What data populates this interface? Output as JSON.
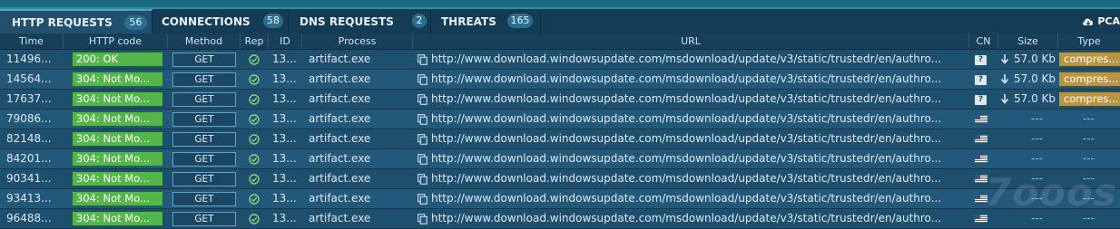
{
  "tabs": [
    {
      "label": "HTTP REQUESTS",
      "count": "56"
    },
    {
      "label": "CONNECTIONS",
      "count": "58"
    },
    {
      "label": "DNS REQUESTS",
      "count": "2"
    },
    {
      "label": "THREATS",
      "count": "165"
    }
  ],
  "pcap_label": "PCA",
  "columns": [
    "Time",
    "HTTP code",
    "Method",
    "Rep",
    "ID",
    "Process",
    "URL",
    "CN",
    "Size",
    "Type"
  ],
  "rows": [
    {
      "time": "11496...",
      "code": "200: OK",
      "method": "GET",
      "id": "13...",
      "process": "artifact.exe",
      "url": "http://www.download.windowsupdate.com/msdownload/update/v3/static/trustedr/en/authro...",
      "cn": "?",
      "size": "57.0 Kb",
      "type": "compres..."
    },
    {
      "time": "14564...",
      "code": "304: Not Mo...",
      "method": "GET",
      "id": "13...",
      "process": "artifact.exe",
      "url": "http://www.download.windowsupdate.com/msdownload/update/v3/static/trustedr/en/authro...",
      "cn": "?",
      "size": "57.0 Kb",
      "type": "compres..."
    },
    {
      "time": "17637...",
      "code": "304: Not Mo...",
      "method": "GET",
      "id": "13...",
      "process": "artifact.exe",
      "url": "http://www.download.windowsupdate.com/msdownload/update/v3/static/trustedr/en/authro...",
      "cn": "?",
      "size": "57.0 Kb",
      "type": "compres..."
    },
    {
      "time": "79086...",
      "code": "304: Not Mo...",
      "method": "GET",
      "id": "13...",
      "process": "artifact.exe",
      "url": "http://www.download.windowsupdate.com/msdownload/update/v3/static/trustedr/en/authro...",
      "cn": "us-flag",
      "size": "---",
      "type": "---"
    },
    {
      "time": "82148...",
      "code": "304: Not Mo...",
      "method": "GET",
      "id": "13...",
      "process": "artifact.exe",
      "url": "http://www.download.windowsupdate.com/msdownload/update/v3/static/trustedr/en/authro...",
      "cn": "us-flag",
      "size": "---",
      "type": "---"
    },
    {
      "time": "84201...",
      "code": "304: Not Mo...",
      "method": "GET",
      "id": "13...",
      "process": "artifact.exe",
      "url": "http://www.download.windowsupdate.com/msdownload/update/v3/static/trustedr/en/authro...",
      "cn": "us-flag",
      "size": "---",
      "type": "---"
    },
    {
      "time": "90341...",
      "code": "304: Not Mo...",
      "method": "GET",
      "id": "13...",
      "process": "artifact.exe",
      "url": "http://www.download.windowsupdate.com/msdownload/update/v3/static/trustedr/en/authro...",
      "cn": "us-flag",
      "size": "---",
      "type": "---"
    },
    {
      "time": "93413...",
      "code": "304: Not Mo...",
      "method": "GET",
      "id": "13...",
      "process": "artifact.exe",
      "url": "http://www.download.windowsupdate.com/msdownload/update/v3/static/trustedr/en/authro...",
      "cn": "us-flag",
      "size": "---",
      "type": "---"
    },
    {
      "time": "96488...",
      "code": "304: Not Mo...",
      "method": "GET",
      "id": "13...",
      "process": "artifact.exe",
      "url": "http://www.download.windowsupdate.com/msdownload/update/v3/static/trustedr/en/authro...",
      "cn": "us-flag",
      "size": "---",
      "type": "---"
    }
  ],
  "watermark": "7ooos"
}
